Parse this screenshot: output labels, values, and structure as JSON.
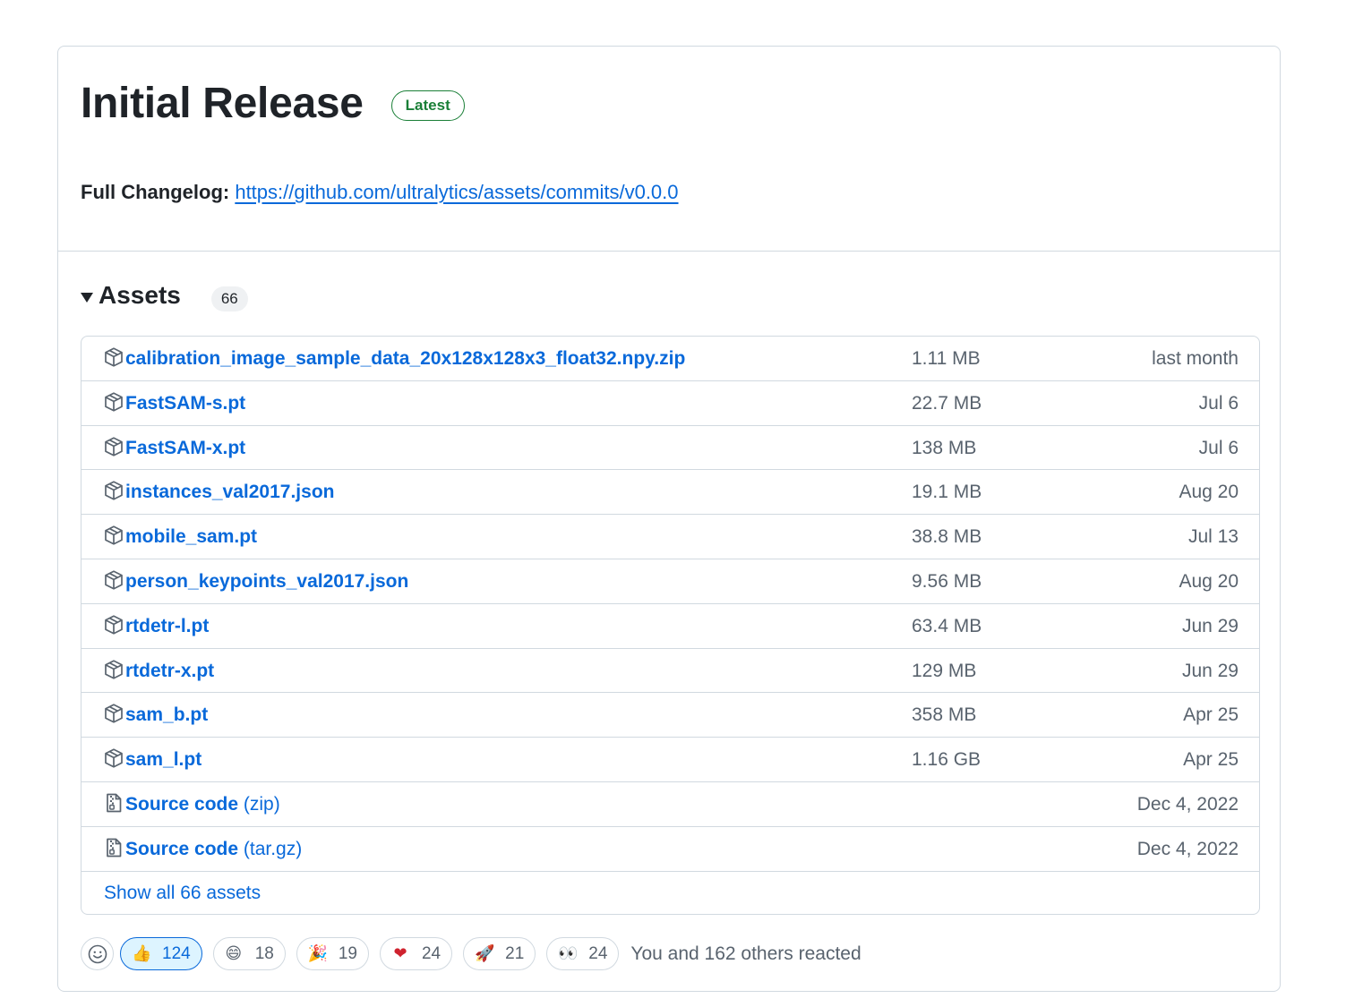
{
  "release": {
    "title": "Initial Release",
    "badge": "Latest",
    "changelog_label": "Full Changelog:",
    "changelog_link": "https://github.com/ultralytics/assets/commits/v0.0.0"
  },
  "assets": {
    "title": "Assets",
    "count": "66",
    "items": [
      {
        "name": "calibration_image_sample_data_20x128x128x3_float32.npy.zip",
        "ext": "",
        "size": "1.11 MB",
        "date": "last month",
        "icon": "package-icon"
      },
      {
        "name": "FastSAM-s.pt",
        "ext": "",
        "size": "22.7 MB",
        "date": "Jul 6",
        "icon": "package-icon"
      },
      {
        "name": "FastSAM-x.pt",
        "ext": "",
        "size": "138 MB",
        "date": "Jul 6",
        "icon": "package-icon"
      },
      {
        "name": "instances_val2017.json",
        "ext": "",
        "size": "19.1 MB",
        "date": "Aug 20",
        "icon": "package-icon"
      },
      {
        "name": "mobile_sam.pt",
        "ext": "",
        "size": "38.8 MB",
        "date": "Jul 13",
        "icon": "package-icon"
      },
      {
        "name": "person_keypoints_val2017.json",
        "ext": "",
        "size": "9.56 MB",
        "date": "Aug 20",
        "icon": "package-icon"
      },
      {
        "name": "rtdetr-l.pt",
        "ext": "",
        "size": "63.4 MB",
        "date": "Jun 29",
        "icon": "package-icon"
      },
      {
        "name": "rtdetr-x.pt",
        "ext": "",
        "size": "129 MB",
        "date": "Jun 29",
        "icon": "package-icon"
      },
      {
        "name": "sam_b.pt",
        "ext": "",
        "size": "358 MB",
        "date": "Apr 25",
        "icon": "package-icon"
      },
      {
        "name": "sam_l.pt",
        "ext": "",
        "size": "1.16 GB",
        "date": "Apr 25",
        "icon": "package-icon"
      },
      {
        "name": "Source code",
        "ext": "(zip)",
        "size": "",
        "date": "Dec 4, 2022",
        "icon": "file-zip-icon"
      },
      {
        "name": "Source code",
        "ext": "(tar.gz)",
        "size": "",
        "date": "Dec 4, 2022",
        "icon": "file-zip-icon"
      }
    ],
    "show_all": "Show all 66 assets"
  },
  "reactions": {
    "items": [
      {
        "emoji": "👍",
        "name": "thumbs-up",
        "count": "124",
        "active": true
      },
      {
        "emoji": "😄",
        "name": "laugh",
        "count": "18",
        "active": false
      },
      {
        "emoji": "🎉",
        "name": "hooray",
        "count": "19",
        "active": false
      },
      {
        "emoji": "❤",
        "name": "heart",
        "count": "24",
        "active": false
      },
      {
        "emoji": "🚀",
        "name": "rocket",
        "count": "21",
        "active": false
      },
      {
        "emoji": "👀",
        "name": "eyes",
        "count": "24",
        "active": false
      }
    ],
    "summary": "You and 162 others reacted"
  },
  "colors": {
    "link": "#0969da",
    "latest_green": "#1a7f37",
    "border": "#d1d9e0",
    "muted_text": "#59636e",
    "active_reaction_bg": "#ddf4ff"
  }
}
